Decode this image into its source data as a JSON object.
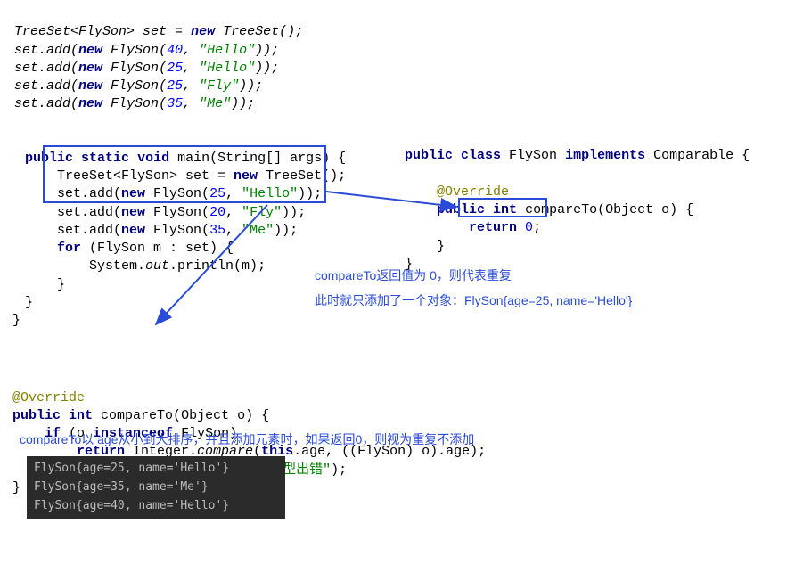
{
  "topCode": [
    "TreeSet<FlySon> set = new TreeSet();",
    "set.add(new FlySon(40, \"Hello\"));",
    "set.add(new FlySon(25, \"Hello\"));",
    "set.add(new FlySon(25, \"Fly\"));",
    "set.add(new FlySon(35, \"Me\"));"
  ],
  "mainMethod": {
    "sig": "public static void main(String[] args) {",
    "line1": "    TreeSet<FlySon> set = new TreeSet();",
    "add1": "    set.add(new FlySon(25, \"Hello\"));",
    "add2": "    set.add(new FlySon(20, \"Fly\"));",
    "add3": "    set.add(new FlySon(35, \"Me\"));",
    "loop": "    for (FlySon m : set) {",
    "print": "        System.out.println(m);",
    "close1": "    }",
    "close2": "}",
    "close3": "}"
  },
  "rightClass": {
    "decl": "public class FlySon implements Comparable {",
    "ann": "@Override",
    "sig": "public int compareTo(Object o) {",
    "ret": "    return 0;",
    "c1": "}",
    "c2": "}"
  },
  "caption1": "compareTo返回值为 0，则代表重复",
  "caption2": "此时就只添加了一个对象：FlySon{age=25, name='Hello'}",
  "compareMethod": {
    "ann": "@Override",
    "sig": "public int compareTo(Object o) {",
    "if": "    if (o instanceof FlySon)",
    "ret": "        return Integer.compare(this.age, ((FlySon) o).age);",
    "thr": "    throw new RuntimeException(\"类型出错\");",
    "c1": "}"
  },
  "caption3": "compareTo以 age从小到大排序，并且添加元素时，如果返回0，则视为重复不添加",
  "terminal": [
    "FlySon{age=25, name='Hello'}",
    "FlySon{age=35, name='Me'}",
    "FlySon{age=40, name='Hello'}"
  ]
}
